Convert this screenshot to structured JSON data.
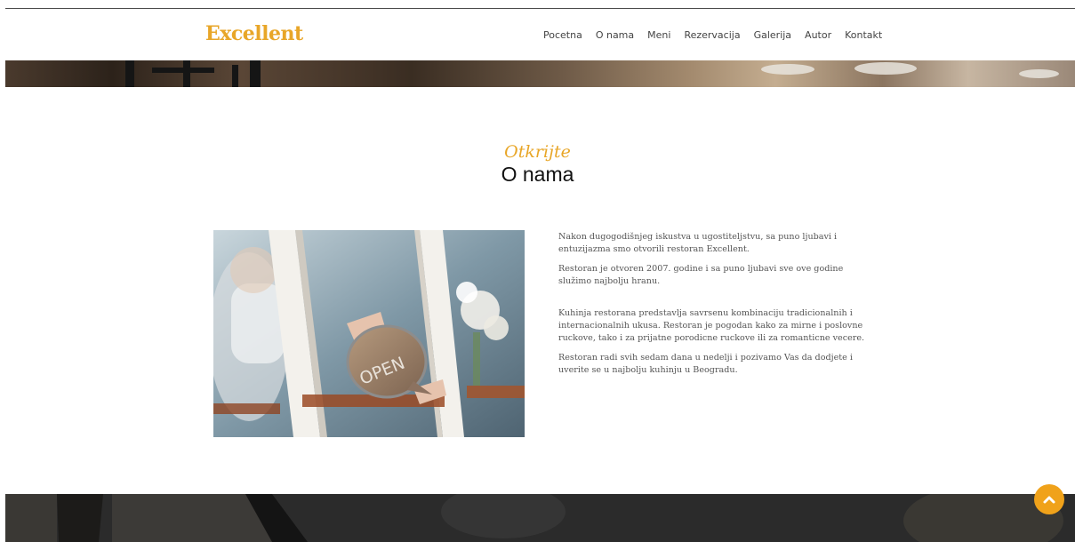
{
  "brand": {
    "name": "Excellent",
    "color": "#e8a628"
  },
  "nav": {
    "items": [
      {
        "label": "Pocetna",
        "name": "nav-pocetna"
      },
      {
        "label": "O nama",
        "name": "nav-o-nama"
      },
      {
        "label": "Meni",
        "name": "nav-meni"
      },
      {
        "label": "Rezervacija",
        "name": "nav-rezervacija"
      },
      {
        "label": "Galerija",
        "name": "nav-galerija"
      },
      {
        "label": "Autor",
        "name": "nav-autor"
      },
      {
        "label": "Kontakt",
        "name": "nav-kontakt"
      }
    ]
  },
  "about": {
    "eyebrow": "Otkrijte",
    "title": "O nama",
    "image": {
      "sign_text": "OPEN"
    },
    "paragraphs": [
      "Nakon dugogodišnjeg iskustva u ugostiteljstvu, sa puno ljubavi i entuzijazma smo otvorili restoran Excellent.",
      "Restoran je otvoren 2007. godine i sa puno ljubavi sve ove godine služimo najbolju hranu.",
      "Kuhinja restorana predstavlja savrsenu kombinaciju tradicionalnih i internacionalnih ukusa. Restoran je pogodan kako za mirne i poslovne ruckove, tako i za prijatne porodicne ruckove ili za romanticne vecere.",
      "Restoran radi svih sedam dana u nedelji i pozivamo Vas da dodjete i uverite se u najbolju kuhinju u Beogradu."
    ]
  },
  "back_to_top": {
    "icon": "chevron-up-icon",
    "color": "#f0a21a"
  }
}
